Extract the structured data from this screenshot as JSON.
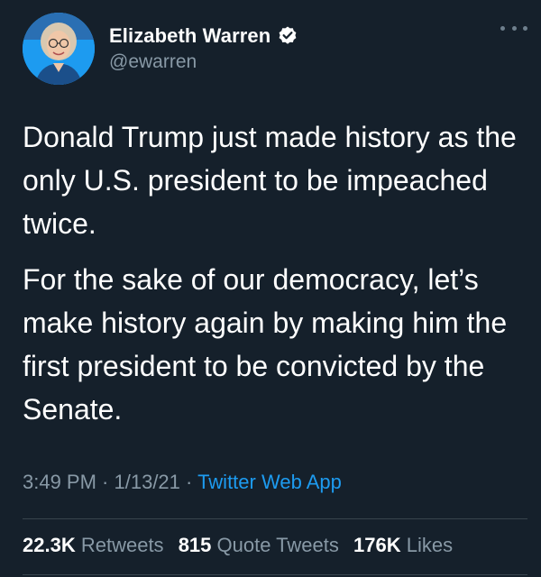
{
  "user": {
    "display_name": "Elizabeth Warren",
    "handle": "@ewarren",
    "verified": true,
    "avatar_icon": "profile-photo"
  },
  "more_icon": "more-options-icon",
  "tweet": {
    "paragraphs": [
      "Donald Trump just made history as the only U.S. president to be impeached twice.",
      "For the sake of our democracy, let’s make history again by making him the first president to be convicted by the Senate."
    ]
  },
  "meta": {
    "time": "3:49 PM",
    "date": "1/13/21",
    "separator": " · ",
    "app": "Twitter Web App"
  },
  "stats": {
    "retweets_count": "22.3K",
    "retweets_label": "Retweets",
    "quote_tweets_count": "815",
    "quote_tweets_label": "Quote Tweets",
    "likes_count": "176K",
    "likes_label": "Likes"
  },
  "colors": {
    "background": "#15202b",
    "secondary_text": "#8899a6",
    "link": "#1d9bf0",
    "divider": "#38444d"
  }
}
